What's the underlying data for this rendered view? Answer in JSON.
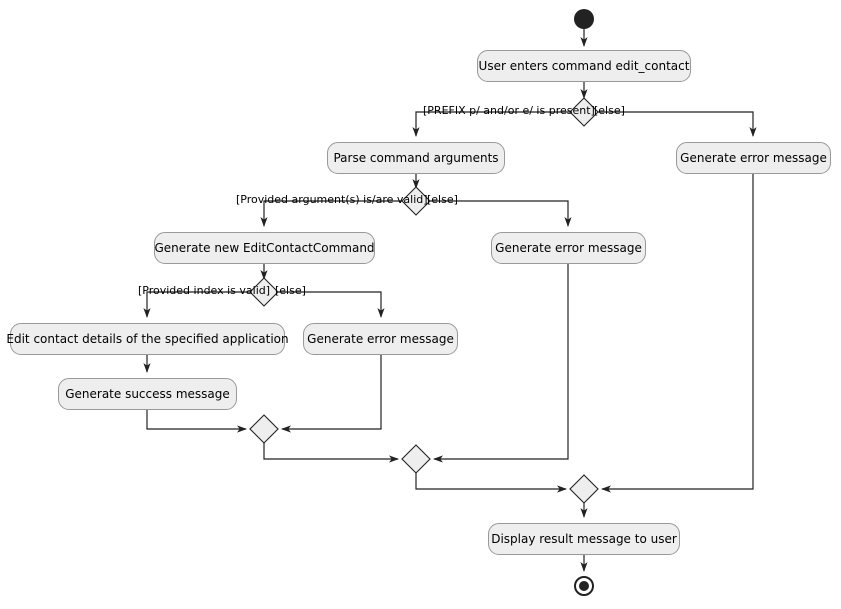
{
  "diagram": {
    "title": "edit_contact command activity diagram",
    "type": "uml-activity-diagram",
    "colors": {
      "activity_fill": "#EEEEEE",
      "activity_border": "#999999",
      "diamond_fill": "#EEEEEE",
      "diamond_border": "#222222",
      "line": "#222222",
      "node_fill": "#222222",
      "background": "#FFFFFF"
    }
  },
  "nodes": {
    "start": {
      "name": "start-node"
    },
    "end": {
      "name": "end-node"
    },
    "a1": {
      "label": "User enters command edit_contact"
    },
    "a2": {
      "label": "Parse command arguments"
    },
    "a3": {
      "label": "Generate error message"
    },
    "a4": {
      "label": "Generate new EditContactCommand"
    },
    "a5": {
      "label": "Generate error message"
    },
    "a6": {
      "label": "Edit contact details of the specified application"
    },
    "a7": {
      "label": "Generate error message"
    },
    "a8": {
      "label": "Generate success message"
    },
    "a9": {
      "label": "Display result message to user"
    }
  },
  "decisions": {
    "d1": {
      "name": "decision-prefix-present"
    },
    "d2": {
      "name": "decision-arguments-valid"
    },
    "d3": {
      "name": "decision-index-valid"
    }
  },
  "merges": {
    "m1": {
      "name": "merge-index-branches"
    },
    "m2": {
      "name": "merge-argument-branches"
    },
    "m3": {
      "name": "merge-prefix-branches"
    }
  },
  "guards": {
    "g1_yes": "[PREFIX p/ and/or e/ is present]",
    "g1_else": "[else]",
    "g2_yes": "[Provided argument(s) is/are valid]",
    "g2_else": "[else]",
    "g3_yes": "[Provided index is valid]",
    "g3_else": "[else]"
  }
}
